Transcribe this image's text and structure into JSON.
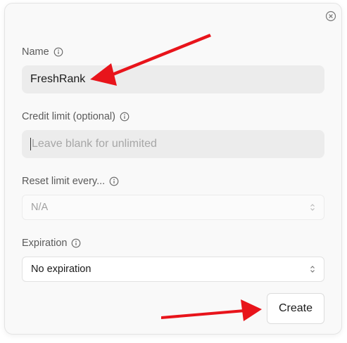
{
  "dialog": {
    "close_icon": "close-circle-icon",
    "name": {
      "label": "Name",
      "value": "FreshRank"
    },
    "credit_limit": {
      "label": "Credit limit (optional)",
      "placeholder": "Leave blank for unlimited",
      "value": ""
    },
    "reset_limit": {
      "label": "Reset limit every...",
      "selected": "N/A"
    },
    "expiration": {
      "label": "Expiration",
      "selected": "No expiration"
    },
    "create_label": "Create"
  },
  "colors": {
    "annotation_arrow": "#e8141b",
    "input_bg": "#ececec",
    "dialog_bg": "#f9f9f9"
  }
}
